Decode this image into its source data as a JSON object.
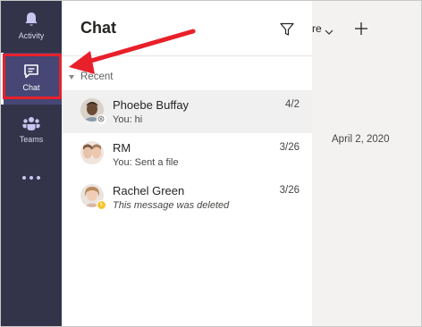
{
  "app_bar": {
    "items": [
      {
        "label": "Activity",
        "icon": "bell-icon"
      },
      {
        "label": "Chat",
        "icon": "chat-icon"
      },
      {
        "label": "Teams",
        "icon": "teams-icon"
      }
    ],
    "more_icon": "more-dots-icon",
    "background": "#33344a"
  },
  "chat_list": {
    "title": "Chat",
    "filter_icon": "filter-icon",
    "dropdown_partial": "re",
    "new_chat_icon": "plus-icon",
    "section_label": "Recent",
    "items": [
      {
        "name": "Phoebe Buffay",
        "preview": "You: hi",
        "date": "4/2",
        "selected": true,
        "status": "away"
      },
      {
        "name": "RM",
        "preview": "You: Sent a file",
        "date": "3/26",
        "selected": false,
        "status": "none"
      },
      {
        "name": "Rachel Green",
        "preview": "This message was deleted",
        "date": "3/26",
        "selected": false,
        "status": "busy"
      }
    ]
  },
  "conversation": {
    "date_divider": "April 2, 2020"
  },
  "colors": {
    "annotation_red": "#e8202a",
    "selected_row": "#f0f0f0"
  }
}
